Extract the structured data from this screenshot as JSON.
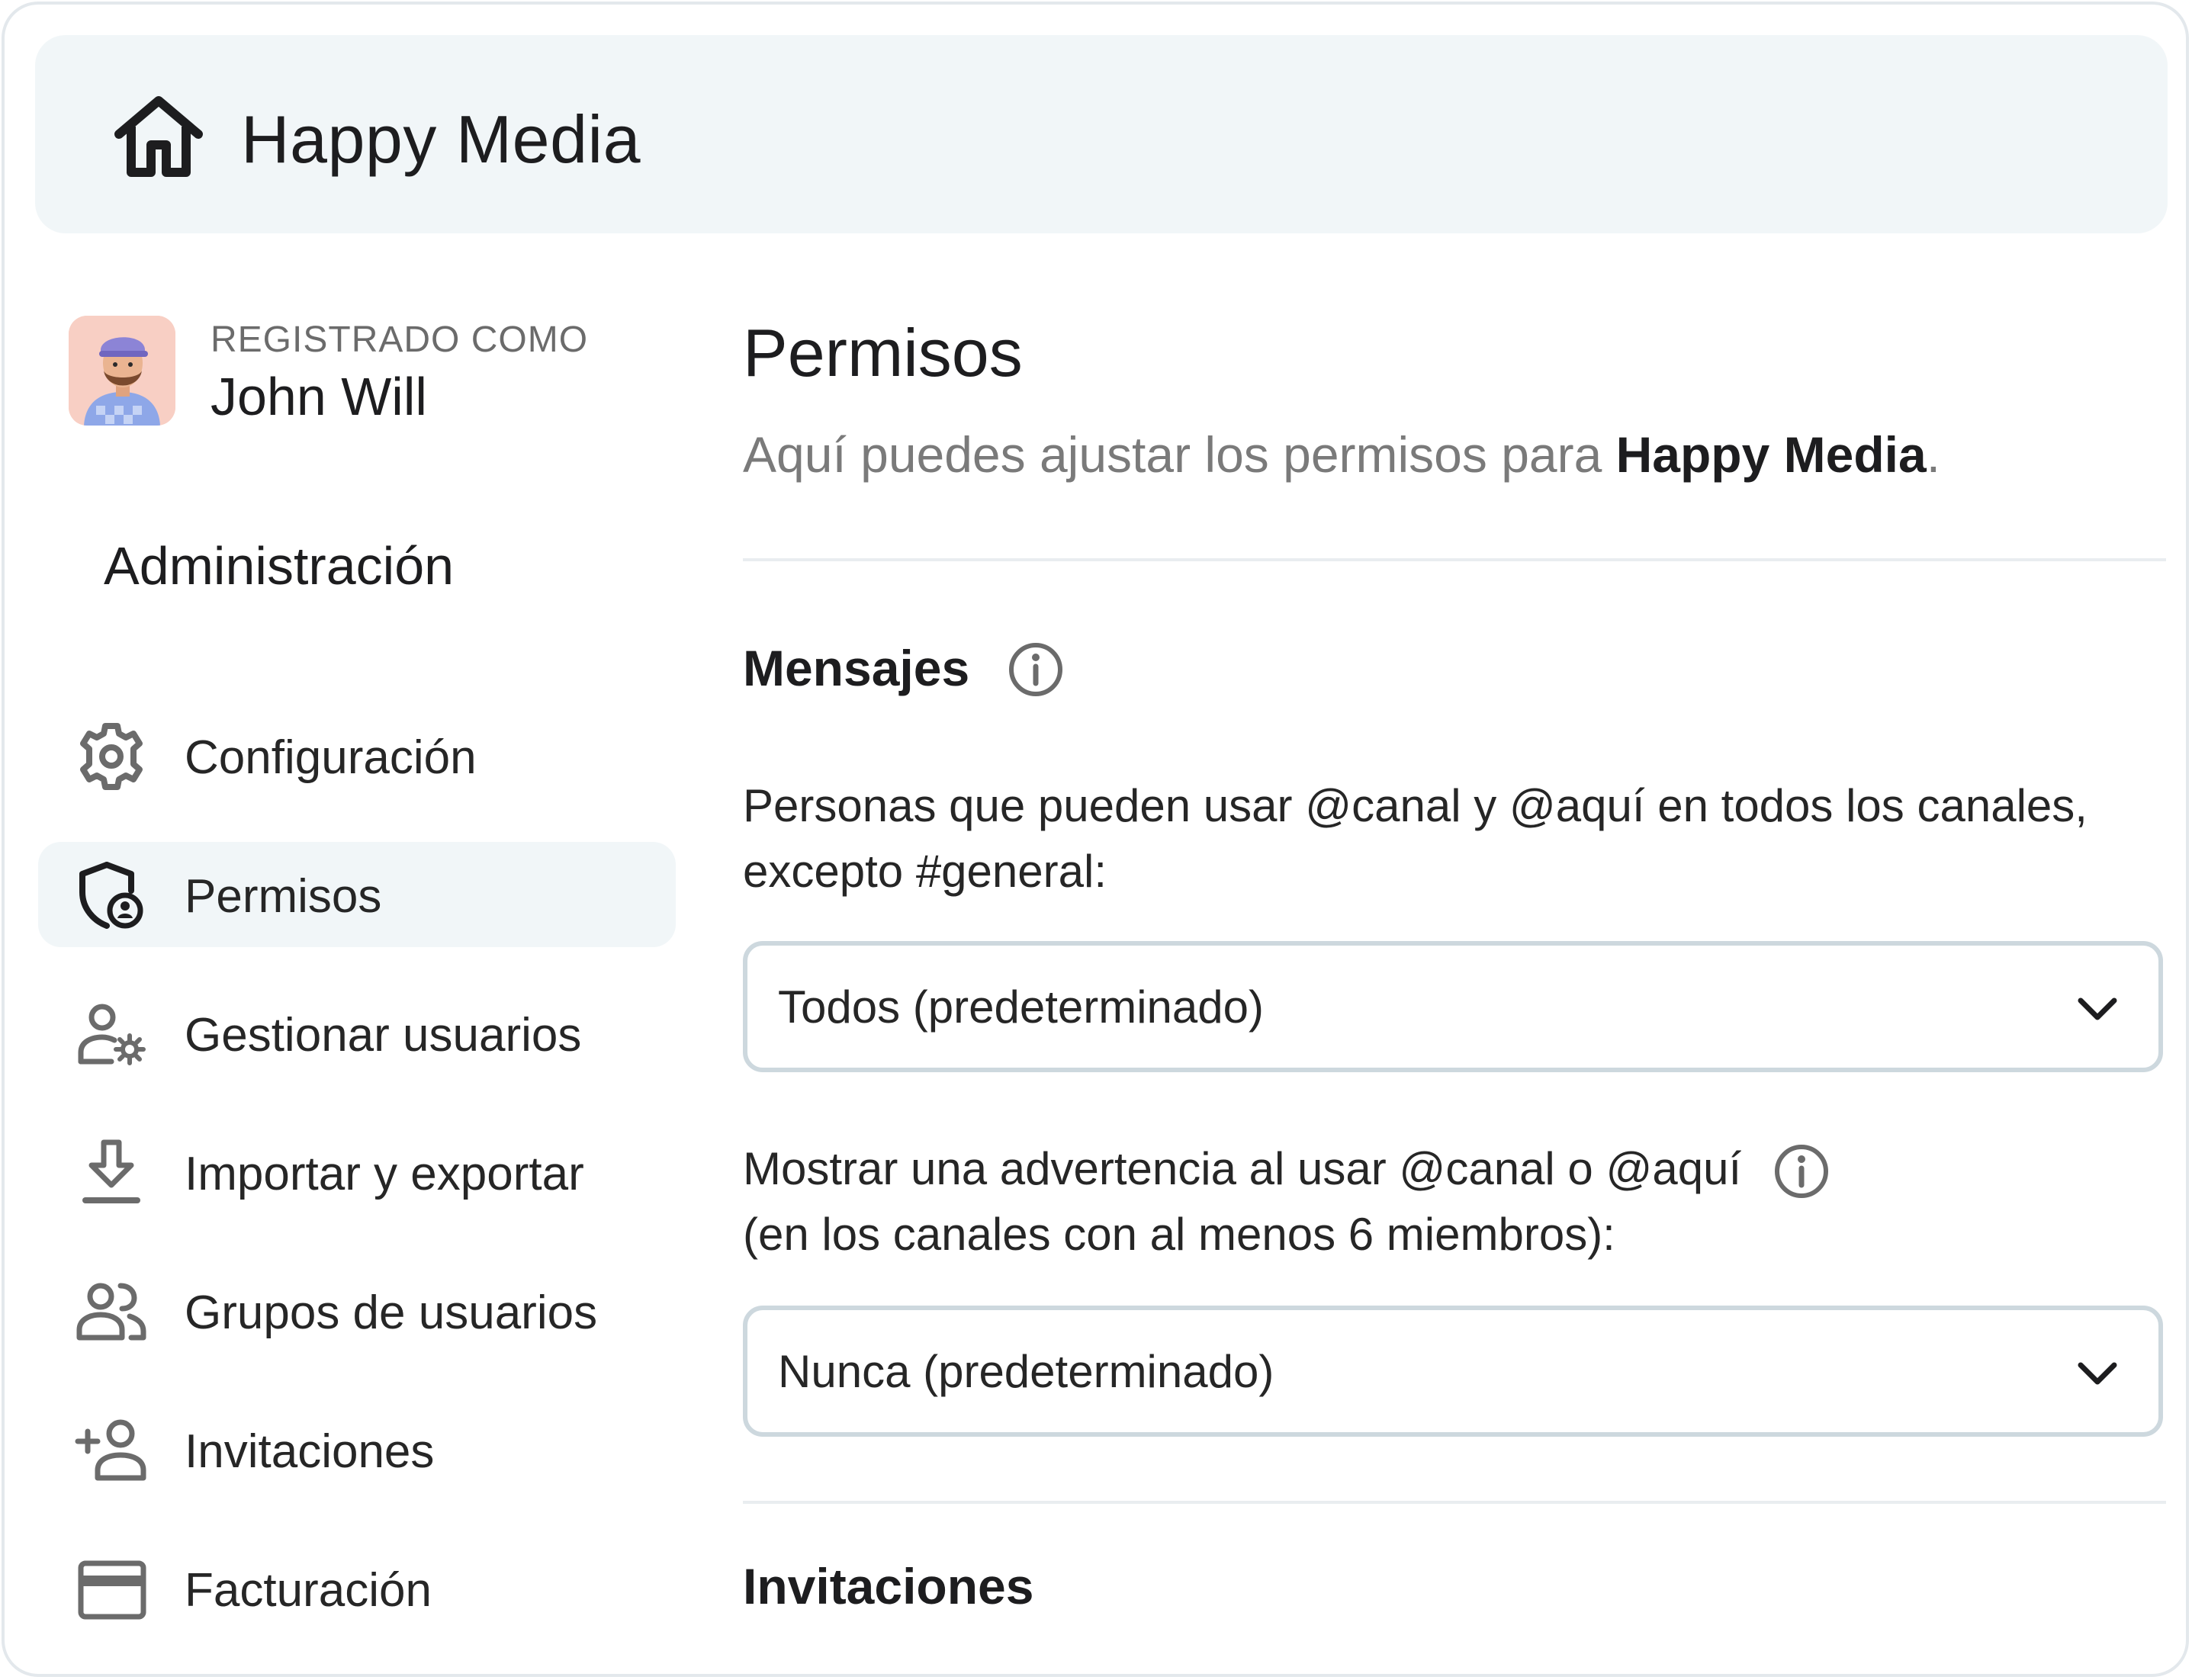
{
  "header": {
    "app_name": "Happy Media",
    "home_icon": "home-icon"
  },
  "sidebar": {
    "logged_in_label": "REGISTRADO COMO",
    "user_name": "John Will",
    "section_title": "Administración",
    "items": [
      {
        "label": "Configuración",
        "icon": "gear-icon",
        "active": false
      },
      {
        "label": "Permisos",
        "icon": "shield-user-icon",
        "active": true
      },
      {
        "label": "Gestionar usuarios",
        "icon": "user-settings-icon",
        "active": false
      },
      {
        "label": "Importar y exportar",
        "icon": "download-icon",
        "active": false
      },
      {
        "label": "Grupos de usuarios",
        "icon": "users-group-icon",
        "active": false
      },
      {
        "label": "Invitaciones",
        "icon": "add-user-icon",
        "active": false
      },
      {
        "label": "Facturación",
        "icon": "credit-card-icon",
        "active": false
      }
    ]
  },
  "main": {
    "title": "Permisos",
    "description_prefix": "Aquí puedes ajustar los permisos para ",
    "description_bold": "Happy Media",
    "description_suffix": ".",
    "messages": {
      "title": "Mensajes",
      "field1_label_line1": "Personas que pueden usar @canal y @aquí en todos los canales,",
      "field1_label_line2": "excepto #general:",
      "field1_value": "Todos (predeterminado)",
      "field2_label_line1": "Mostrar una advertencia al usar @canal o @aquí",
      "field2_label_line2": "(en los canales con al menos 6 miembros):",
      "field2_value": "Nunca (predeterminado)"
    },
    "invitations": {
      "title": "Invitaciones"
    }
  },
  "colors": {
    "header_bg": "#f1f6f8",
    "active_item_bg": "#f1f6f8",
    "select_border": "#cdd8de",
    "text_primary": "#1d1d1f",
    "text_secondary": "#7a7a7a"
  }
}
